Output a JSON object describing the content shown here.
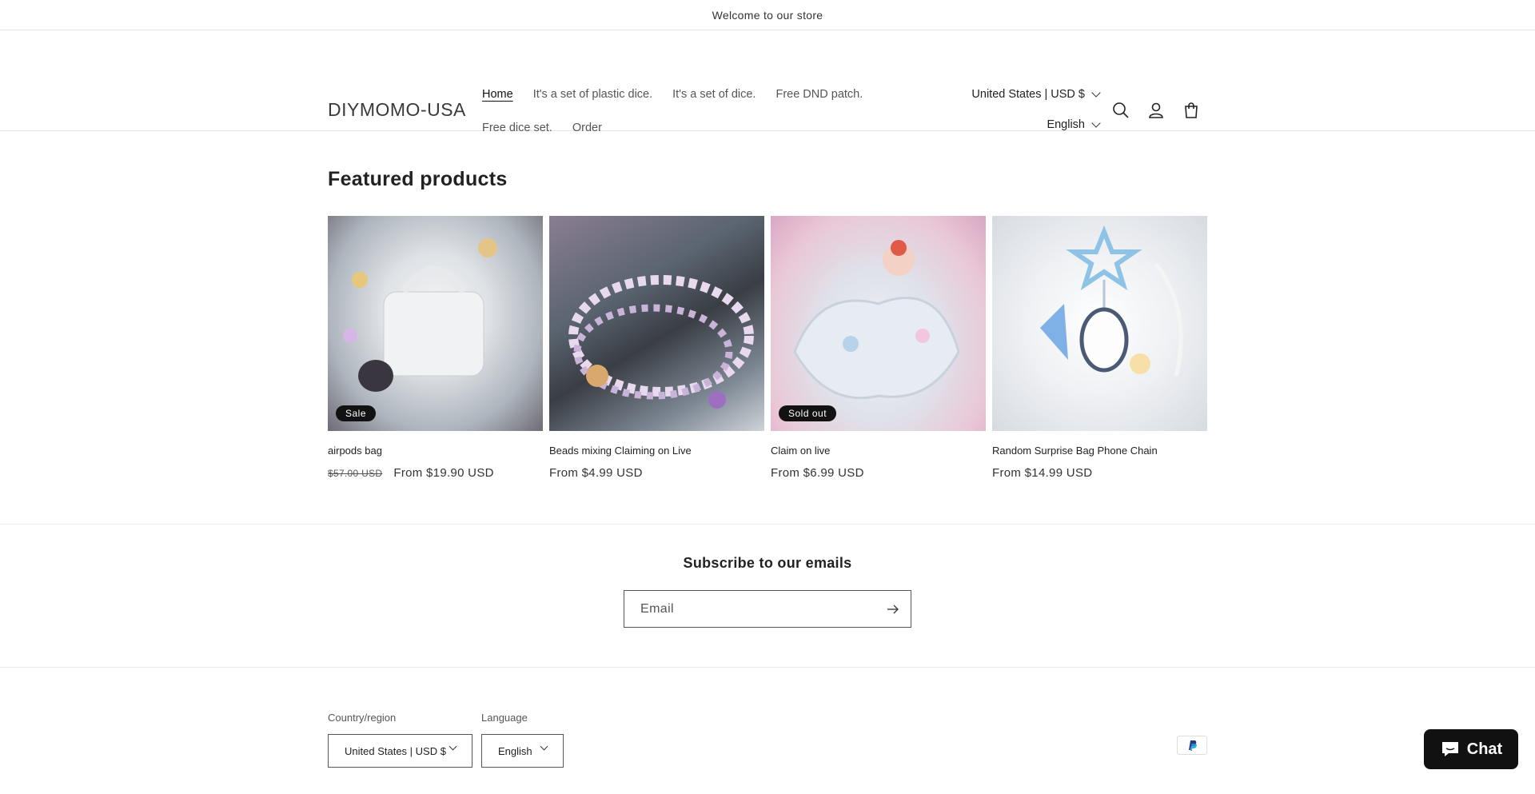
{
  "announcement": "Welcome to our store",
  "header": {
    "logo": "DIYMOMO-USA",
    "nav": [
      "Home",
      "It's a set of plastic dice.",
      "It's a set of dice.",
      "Free DND patch.",
      "Free dice set.",
      "Order"
    ],
    "country_selector": "United States | USD $",
    "language_selector": "English"
  },
  "featured": {
    "title": "Featured products",
    "products": [
      {
        "title": "airpods bag",
        "price": "From $19.90 USD",
        "compare_price": "$57.00 USD",
        "badge": "Sale",
        "image_colors": [
          "#cfd4d9",
          "#f1f2f3",
          "#9ea7b0"
        ]
      },
      {
        "title": "Beads mixing Claiming on Live",
        "price": "From $4.99 USD",
        "compare_price": "",
        "badge": "",
        "image_colors": [
          "#6a7380",
          "#d9cfe3",
          "#3d3f45"
        ]
      },
      {
        "title": "Claim on live",
        "price": "From $6.99 USD",
        "compare_price": "",
        "badge": "Sold out",
        "image_colors": [
          "#dfe3ea",
          "#f0e2ea",
          "#b6c7d8"
        ]
      },
      {
        "title": "Random Surprise Bag Phone Chain",
        "price": "From $14.99 USD",
        "compare_price": "",
        "badge": "",
        "image_colors": [
          "#eceef2",
          "#8fb6df",
          "#ffffff"
        ]
      }
    ]
  },
  "newsletter": {
    "title": "Subscribe to our emails",
    "placeholder": "Email"
  },
  "footer": {
    "country_label": "Country/region",
    "country_value": "United States | USD $",
    "language_label": "Language",
    "language_value": "English",
    "payment_icon": "paypal-icon"
  },
  "chat": {
    "label": "Chat"
  }
}
